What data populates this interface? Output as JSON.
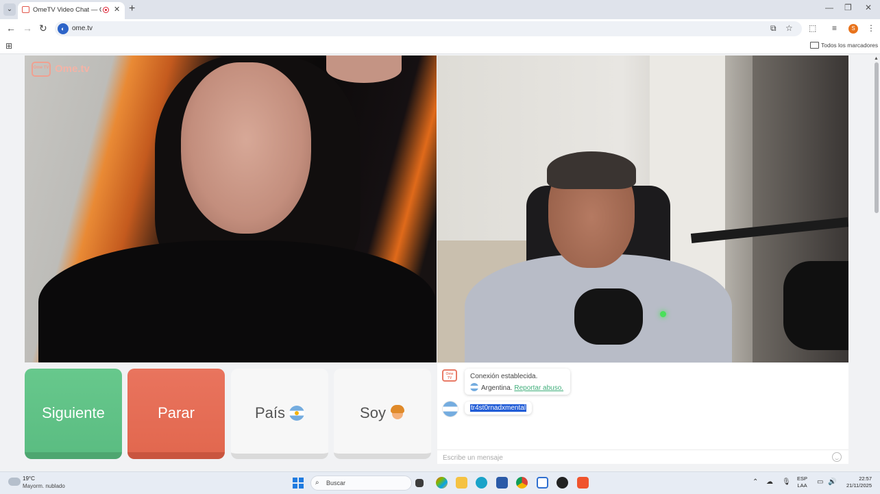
{
  "browser": {
    "tab_title": "OmeTV Video Chat — Omegle",
    "tab_close": "✕",
    "new_tab": "+",
    "url": "ome.tv",
    "profile_initial": "S",
    "bookmarks_label": "Todos los marcadores"
  },
  "site": {
    "logo_badge": "Ome TV",
    "logo_text": "Ome.tv"
  },
  "controls": {
    "next_label": "Siguiente",
    "stop_label": "Parar",
    "country_label": "País",
    "gender_label": "Soy"
  },
  "chat": {
    "bot_badge": "Ome TV",
    "system_message": "Conexión establecida.",
    "country": "Argentina.",
    "report_link": "Reportar abuso.",
    "user_message": "tr4st0rnadxmental",
    "input_placeholder": "Escribe un mensaje"
  },
  "taskbar": {
    "temperature": "19°C",
    "weather": "Mayorm. nublado",
    "search_placeholder": "Buscar",
    "lang_primary": "ESP",
    "lang_secondary": "LAA",
    "time": "22:57",
    "date": "21/11/2025"
  },
  "colors": {
    "next": "#5bbd82",
    "stop": "#e2684f",
    "accent_link": "#3fae7a",
    "selection": "#1f5bd6"
  }
}
